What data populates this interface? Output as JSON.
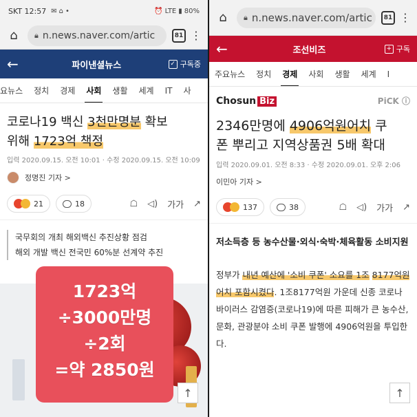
{
  "left": {
    "status": {
      "carrier_time": "SKT 12:57",
      "battery": "80%",
      "network": "LTE"
    },
    "browser": {
      "url": "n.news.naver.com/artic",
      "tab_count": "81"
    },
    "header": {
      "site": "파이낸셜뉴스",
      "subscribe": "구독중"
    },
    "nav": [
      "요뉴스",
      "정치",
      "경제",
      "사회",
      "생활",
      "세계",
      "IT",
      "사"
    ],
    "nav_active": 3,
    "headline": {
      "pre": "코로나19 백신 ",
      "hl1": "3천만명분",
      " mid": "",
      "mid": " 확보",
      "line2_pre": "위해 ",
      "hl2": "1723억 책정",
      "post": ""
    },
    "date": "입력 2020.09.15. 오전 10:01 · 수정 2020.09.15. 오전 10:09",
    "reporter": "정명진 기자 >",
    "reactions": "21",
    "comments": "18",
    "font_tool": "가가",
    "subtitle": [
      "국무회의 개최 해외백신 추진상황 점검",
      "해외 개발 백신 전국민 60%분 선계약 추진"
    ],
    "overlay": [
      "1723억",
      "÷3000만명",
      "÷2회",
      "=약 2850원"
    ]
  },
  "right": {
    "browser": {
      "url": "n.news.naver.com/artic",
      "tab_count": "81"
    },
    "header": {
      "site": "조선비즈",
      "subscribe": "구독"
    },
    "nav": [
      "주요뉴스",
      "정치",
      "경제",
      "사회",
      "생활",
      "세계",
      "I"
    ],
    "nav_active": 2,
    "logo": {
      "main": "Chosun",
      "biz": "Biz",
      "pick": "PiCK ⓘ"
    },
    "headline": {
      "pre": "2346만명에 ",
      "hl1": "4906억원어치",
      "post": " 쿠",
      "line2": "폰 뿌리고 지역상품권 5배 확대"
    },
    "date": "입력 2020.09.01. 오전 8:33 · 수정 2020.09.01. 오후 2:06",
    "reporter": "이민아 기자 >",
    "reactions": "137",
    "comments": "38",
    "font_tool": "가가",
    "lead": "저소득층 등 농수산물·외식·숙박·체육활동 소비지원",
    "body": {
      "pre": "정부가 ",
      "hl1": "내년 예산에 '소비 쿠폰' 소요를 1조",
      "hl2": "8177억원 어치 포함시켰다",
      "post": ". 1조8177억원 가운데 신종 코로나 바이러스 감염증(코로나19)에 따른 피해가 큰 농수산, 문화, 관광분야 소비 쿠폰 발행에 4906억원을 투입한다."
    }
  }
}
